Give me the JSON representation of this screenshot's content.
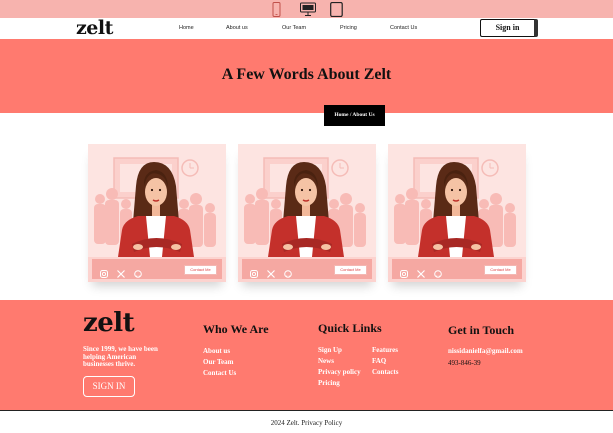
{
  "devices": [
    {
      "name": "mobile-device-icon"
    },
    {
      "name": "desktop-device-icon"
    },
    {
      "name": "tablet-device-icon"
    }
  ],
  "nav": {
    "logo": "zelt",
    "links": [
      "Home",
      "About us",
      "Our Team",
      "Pricing",
      "Contact Us"
    ],
    "signin": "Sign in"
  },
  "hero": {
    "title": "A Few Words About Zelt",
    "breadcrumb": "Home / About Us"
  },
  "cards": [
    {
      "button": "Contact Me"
    },
    {
      "button": "Contact Me"
    },
    {
      "button": "Contact Me"
    }
  ],
  "footer": {
    "logo": "zelt",
    "about": "Since 1999, we have been helping American businesses thrive.",
    "signin": "SIGN IN",
    "who_title": "Who We Are",
    "who_links": [
      "About us",
      "Our Team",
      "Contact Us"
    ],
    "quick_title": "Quick Links",
    "quick_col1": [
      "Sign Up",
      "News",
      "Privacy policy",
      "Pricing"
    ],
    "quick_col2": [
      "Features",
      "FAQ",
      "Contacts"
    ],
    "touch_title": "Get in Touch",
    "email": "nissidanielfa@gmail.com",
    "phone": "493-846-39",
    "copyright": "2024 Zelt. Privacy Policy"
  },
  "colors": {
    "accent": "#ff7a6f",
    "topbar": "#f7b3ae",
    "card_bg": "#fde4e1"
  }
}
